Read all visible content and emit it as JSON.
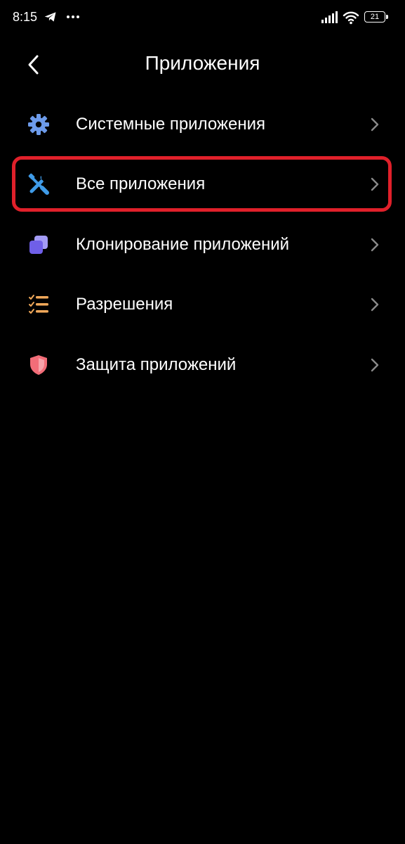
{
  "status_bar": {
    "time": "8:15",
    "battery_level": "21",
    "icons": [
      "telegram-icon",
      "more-dots-icon",
      "signal-icon",
      "wifi-icon",
      "battery-icon"
    ]
  },
  "header": {
    "title": "Приложения",
    "back_icon": "chevron-left-icon"
  },
  "menu": {
    "items": [
      {
        "label": "Системные приложения",
        "icon": "gear-icon",
        "icon_color": "#6d9bea"
      },
      {
        "label": "Все приложения",
        "icon": "tools-icon",
        "icon_color": "#3f9be8",
        "highlighted": true
      },
      {
        "label": "Клонирование приложений",
        "icon": "clone-icon",
        "icon_color": "#7a6ef0"
      },
      {
        "label": "Разрешения",
        "icon": "checklist-icon",
        "icon_color": "#f0a85a"
      },
      {
        "label": "Защита приложений",
        "icon": "shield-icon",
        "icon_color": "#f26d78"
      }
    ]
  },
  "colors": {
    "background": "#000000",
    "text": "#ffffff",
    "chevron": "#8a8a8a",
    "highlight_frame": "#e0202a"
  }
}
